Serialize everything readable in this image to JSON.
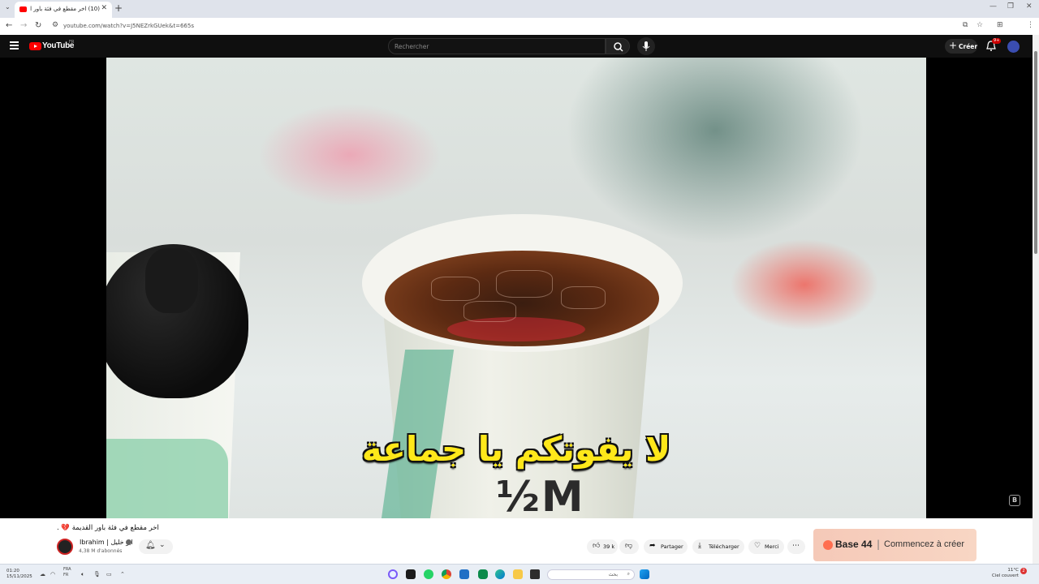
{
  "browser": {
    "tab_title": "(10) اخر مقطع في فئة باور القديمة 💔 - YouTube",
    "new_tab": "+",
    "close": "✕",
    "url": "youtube.com/watch?v=J5NEZrkGUek&t=665s",
    "win_min": "—",
    "win_max": "❐",
    "win_close": "✕"
  },
  "header": {
    "logo_text": "YouTube",
    "country_code": "FR",
    "search_placeholder": "Rechercher",
    "create_label": "Créer",
    "notif_count": "9+"
  },
  "video": {
    "subtitle": "لا يفوتكم يا جماعة",
    "cup_print": "½M",
    "watermark": "B"
  },
  "info": {
    "title": "اخر مقطع في فئة باور القديمة 💔 .",
    "channel_name": "Ibrahim | ابو خليل",
    "subscribers": "4,38 M d'abonnés",
    "like_count": "39 k",
    "share_label": "Partager",
    "download_label": "Télécharger",
    "thanks_label": "Merci",
    "more_label": "⋯"
  },
  "ad": {
    "brand": "Base 44",
    "separator": "|",
    "cta": "Commencez à créer"
  },
  "taskbar": {
    "time": "01:20",
    "date": "15/11/2025",
    "lang_1": "FRA",
    "lang_2": "FR",
    "search_placeholder": "بحث",
    "temp": "11°C",
    "weather": "Ciel couvert",
    "notif_count": "2"
  },
  "colors": {
    "youtube_red": "#ff0000",
    "subtitle_yellow": "#ffe81a",
    "ad_background": "#f8d6c4"
  }
}
